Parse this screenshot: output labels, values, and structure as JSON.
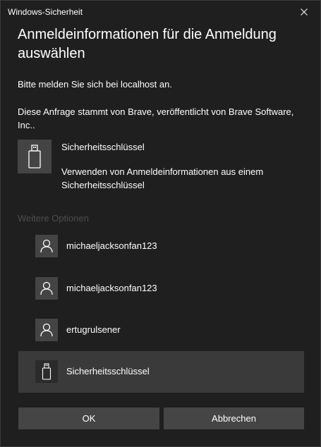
{
  "window": {
    "title": "Windows-Sicherheit"
  },
  "dialog": {
    "heading": "Anmeldeinformationen für die Anmeldung auswählen",
    "signin_text": "Bitte melden Sie sich bei localhost an.",
    "origin_text": "Diese Anfrage stammt von Brave, veröffentlicht von Brave Software, Inc..",
    "selected_credential": {
      "icon": "usb-key-icon",
      "name": "Sicherheitsschlüssel",
      "description": "Verwenden von Anmeldeinformationen aus einem Sicherheitsschlüssel"
    },
    "more_options_label": "Weitere Optionen",
    "options": [
      {
        "icon": "user-icon",
        "label": "michaeljacksonfan123"
      },
      {
        "icon": "user-icon",
        "label": "michaeljacksonfan123"
      },
      {
        "icon": "user-icon",
        "label": "ertugrulsener"
      },
      {
        "icon": "usb-key-icon",
        "label": "Sicherheitsschlüssel",
        "selected": true
      }
    ],
    "buttons": {
      "ok": "OK",
      "cancel": "Abbrechen"
    }
  },
  "colors": {
    "background": "#1f1f1f",
    "tile": "#444444",
    "selected_row": "#3a3a3a",
    "button": "#454545",
    "muted_text": "#4d4d4d"
  }
}
